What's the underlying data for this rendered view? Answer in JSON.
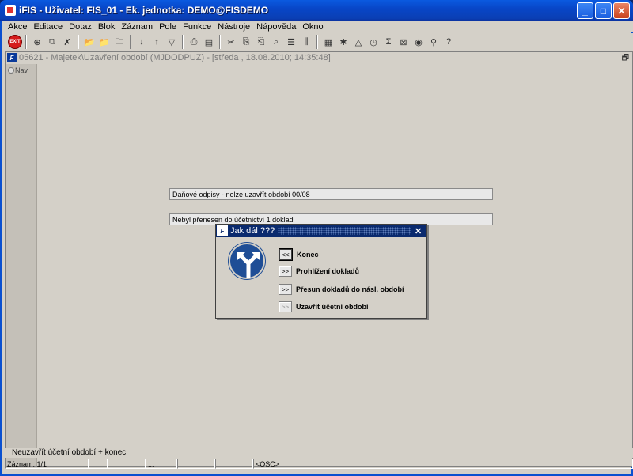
{
  "window": {
    "title": "iFIS - Uživatel: FIS_01 - Ek. jednotka: DEMO@FISDEMO",
    "minimize": "_",
    "maximize": "□",
    "close": "✕"
  },
  "menu": [
    "Akce",
    "Editace",
    "Dotaz",
    "Blok",
    "Záznam",
    "Pole",
    "Funkce",
    "Nástroje",
    "Nápověda",
    "Okno"
  ],
  "toolbar": {
    "exit_label": "EXIT",
    "icons": [
      "exit-icon",
      "insert-record-icon",
      "duplicate-record-icon",
      "delete-record-icon",
      "folder-open-icon",
      "folder-save-icon",
      "folder-delete-icon",
      "sort-asc-icon",
      "sort-desc-icon",
      "filter-icon",
      "print-icon",
      "print-preview-icon",
      "cut-icon",
      "copy-icon",
      "paste-icon",
      "find-icon",
      "list-icon",
      "columns-icon",
      "calendar-icon",
      "settings-icon",
      "chart-icon",
      "clock-icon",
      "sum-icon",
      "excel-icon",
      "export-icon",
      "help-search-icon",
      "help-icon"
    ]
  },
  "inner_window": {
    "title": "05621 - Majetek\\Uzavření období (MJDODPUZ) - [středa , 18.08.2010; 14:35:48]",
    "restore": "🗗",
    "fs_logo": "F",
    "nav_label": "Nav"
  },
  "messages": {
    "line1": "Daňové odpisy - nelze uzavřít období 00/08",
    "line2": "Nebyl přenesen do účetnictví 1 doklad"
  },
  "dialog": {
    "title": "Jak dál ???",
    "close": "✕",
    "options": [
      {
        "button": "<<",
        "label": "Konec",
        "state": "selected"
      },
      {
        "button": ">>",
        "label": "Prohlížení dokladů",
        "state": "normal"
      },
      {
        "button": ">>",
        "label": "Přesun dokladů do násl. období",
        "state": "normal"
      },
      {
        "button": ">>",
        "label": "Uzavřít účetní období",
        "state": "disabled"
      }
    ]
  },
  "status": {
    "hint": "Neuzavřít účetní období + konec",
    "record": "Záznam: 1/1",
    "ellipsis": "...",
    "osc": "<OSC>"
  }
}
